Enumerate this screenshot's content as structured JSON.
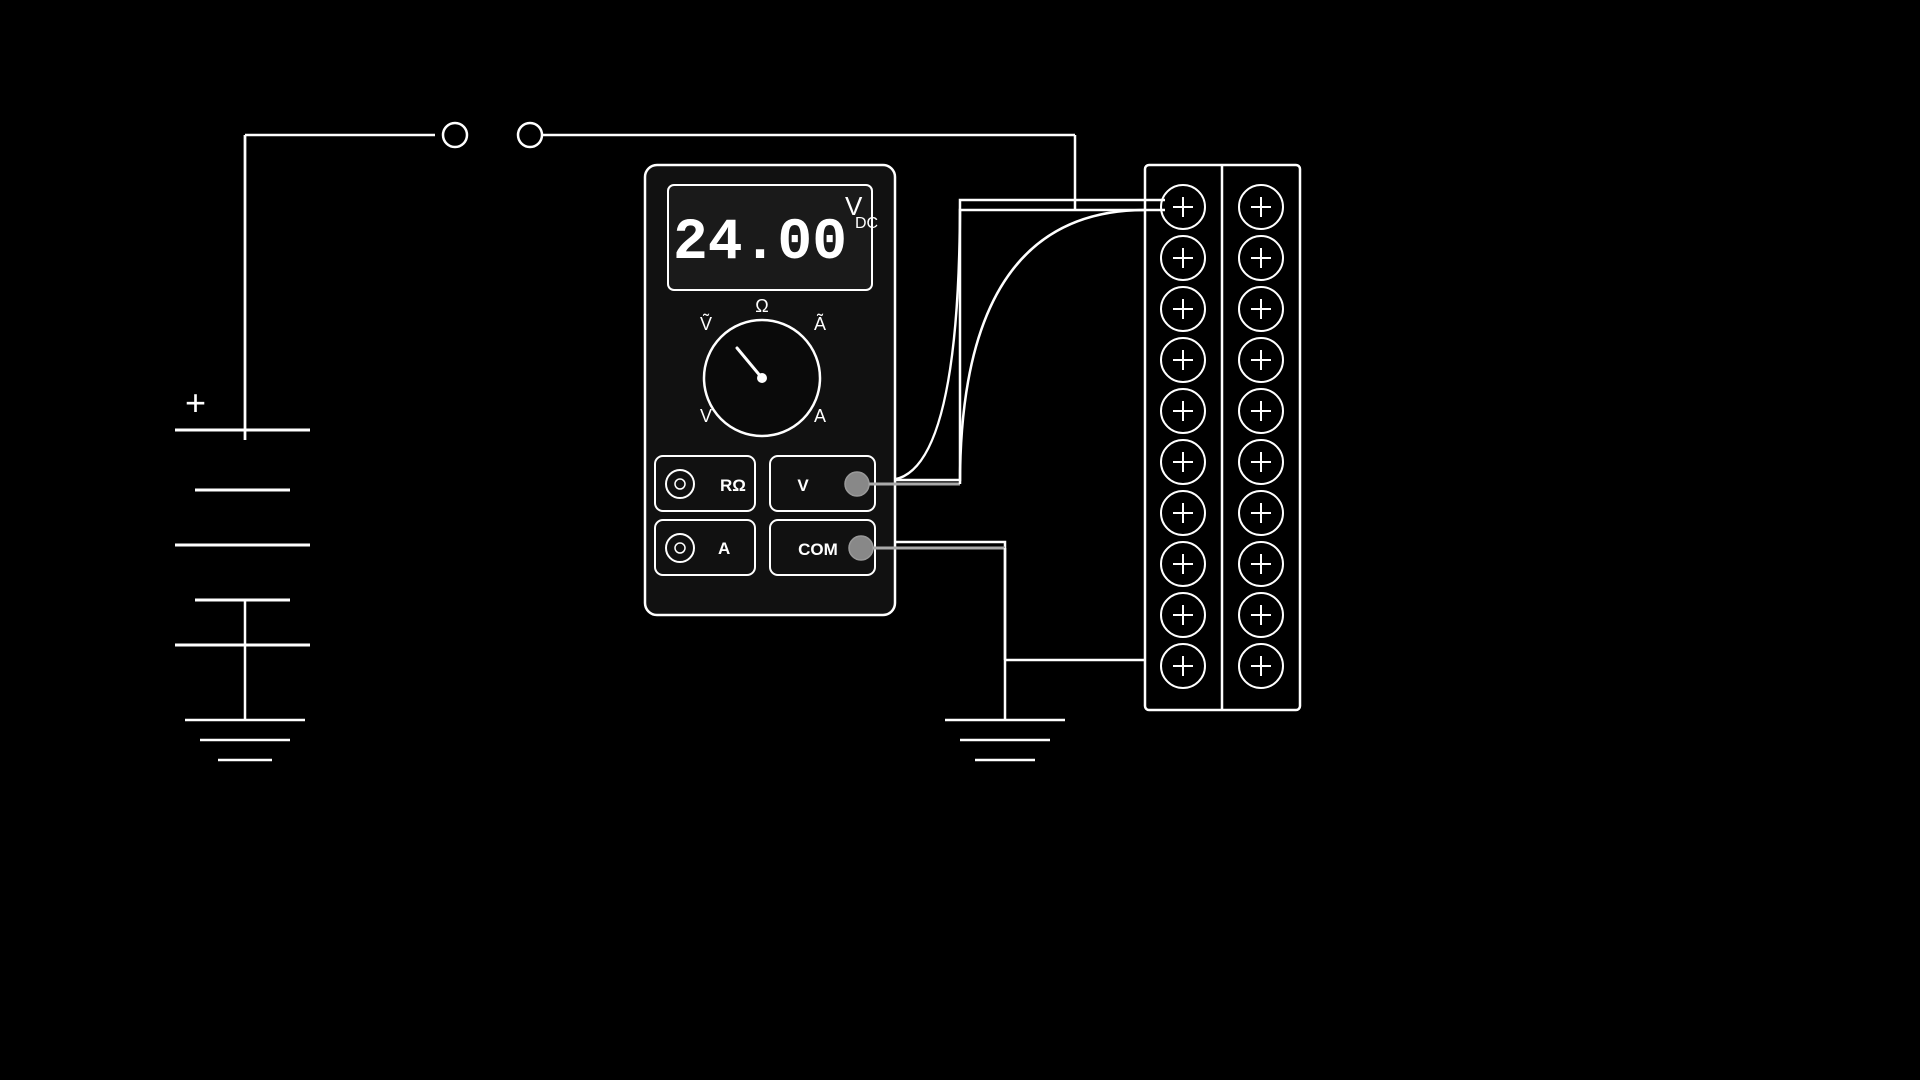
{
  "display": {
    "value": "24.00",
    "unit": "V",
    "subscript": "DC"
  },
  "multimeter": {
    "dial_labels": {
      "top": "Ω",
      "top_left": "Ṽ",
      "top_right": "Ã",
      "bottom_left": "V",
      "bottom_right": "A"
    },
    "ports": {
      "left_top_label": "RΩ",
      "left_bottom_label": "A",
      "right_top_label": "V",
      "right_bottom_label": "COM"
    }
  },
  "circuit": {
    "battery_plus": "+",
    "battery_minus": "−",
    "ground_symbol": "ground"
  },
  "colors": {
    "foreground": "#ffffff",
    "background": "#000000",
    "display_bg": "#1a1a1a",
    "meter_body": "#1a1a1a",
    "meter_border": "#ffffff"
  }
}
